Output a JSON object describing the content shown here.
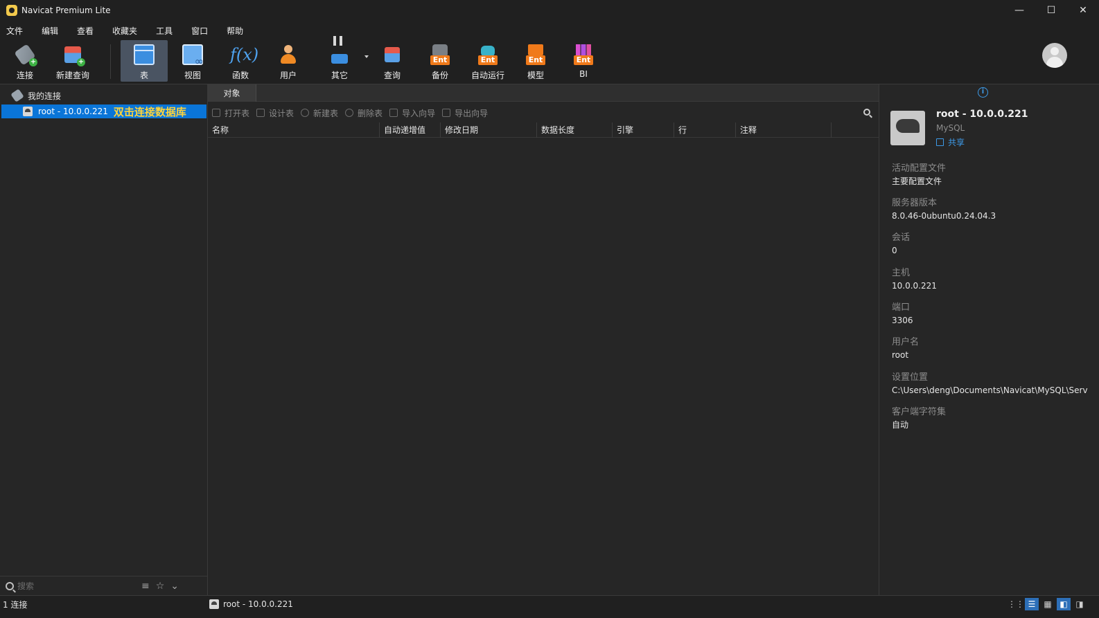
{
  "window": {
    "title": "Navicat Premium Lite",
    "controls": {
      "minimize": "—",
      "maximize": "☐",
      "close": "✕"
    }
  },
  "menu": [
    "文件",
    "编辑",
    "查看",
    "收藏夹",
    "工具",
    "窗口",
    "帮助"
  ],
  "toolbar": {
    "connect": "连接",
    "new_query": "新建查询",
    "table": "表",
    "view": "视图",
    "function": "函数",
    "user": "用户",
    "other": "其它",
    "query": "查询",
    "backup": "备份",
    "automation": "自动运行",
    "model": "模型",
    "bi": "BI",
    "ent_badge": "Ent",
    "active_item": "表"
  },
  "sidebar": {
    "root_label": "我的连接",
    "connection_label": "root - 10.0.0.221",
    "hint": "双击连接数据库",
    "search_placeholder": "搜索"
  },
  "center": {
    "tab": "对象",
    "actions": {
      "open_table": "打开表",
      "design_table": "设计表",
      "new_table": "新建表",
      "delete_table": "删除表",
      "import_wizard": "导入向导",
      "export_wizard": "导出向导"
    },
    "columns": [
      "名称",
      "自动递增值",
      "修改日期",
      "数据长度",
      "引擎",
      "行",
      "注释"
    ]
  },
  "info": {
    "name": "root - 10.0.0.221",
    "type": "MySQL",
    "share": "共享",
    "props": [
      {
        "label": "活动配置文件",
        "value": "主要配置文件"
      },
      {
        "label": "服务器版本",
        "value": "8.0.46-0ubuntu0.24.04.3"
      },
      {
        "label": "会话",
        "value": "0"
      },
      {
        "label": "主机",
        "value": "10.0.0.221"
      },
      {
        "label": "端口",
        "value": "3306"
      },
      {
        "label": "用户名",
        "value": "root"
      },
      {
        "label": "设置位置",
        "value": "C:\\Users\\deng\\Documents\\Navicat\\MySQL\\Serv"
      },
      {
        "label": "客户端字符集",
        "value": "自动"
      }
    ]
  },
  "status": {
    "connections": "1 连接",
    "current_connection": "root - 10.0.0.221"
  },
  "colors": {
    "background": "#2b2b2b",
    "selection": "#0a75d8",
    "hint": "#ffd43b",
    "accent": "#3d9be9",
    "ent_badge": "#f07a1a"
  }
}
